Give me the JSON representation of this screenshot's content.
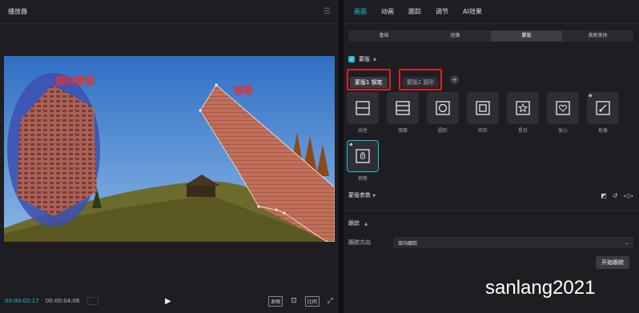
{
  "player": {
    "title": "播放器",
    "overlay_circle_label": "圆形蒙版",
    "overlay_pen_label": "钢笔",
    "time_current": "00:00:02:17",
    "time_total": "00:00:04:06",
    "btn_original": "原图",
    "btn_ratio": "比例"
  },
  "panel": {
    "top_tabs": [
      "画面",
      "动画",
      "跟踪",
      "调节",
      "AI效果"
    ],
    "sub_tabs": [
      "基础",
      "抠像",
      "蒙版",
      "美颜美体"
    ],
    "mask_section_title": "蒙版",
    "mask_chips": [
      "蒙版1 钢笔",
      "蒙版2 圆形"
    ],
    "shapes": [
      {
        "label": "线性",
        "icon": "linear-icon"
      },
      {
        "label": "镜面",
        "icon": "mirror-icon"
      },
      {
        "label": "圆形",
        "icon": "circle-icon"
      },
      {
        "label": "矩形",
        "icon": "rectangle-icon"
      },
      {
        "label": "星形",
        "icon": "star-icon"
      },
      {
        "label": "爱心",
        "icon": "heart-icon"
      },
      {
        "label": "抠像",
        "icon": "brush-icon"
      },
      {
        "label": "钢笔",
        "icon": "pen-icon"
      }
    ],
    "params_label": "蒙版参数",
    "tracking_title": "跟踪",
    "tracking_direction_label": "跟踪方向",
    "tracking_direction_value": "双向跟踪",
    "start_tracking": "开始跟踪"
  },
  "watermark": "sanlang2021",
  "colors": {
    "accent": "#23c0d6",
    "highlight": "#e02020"
  }
}
